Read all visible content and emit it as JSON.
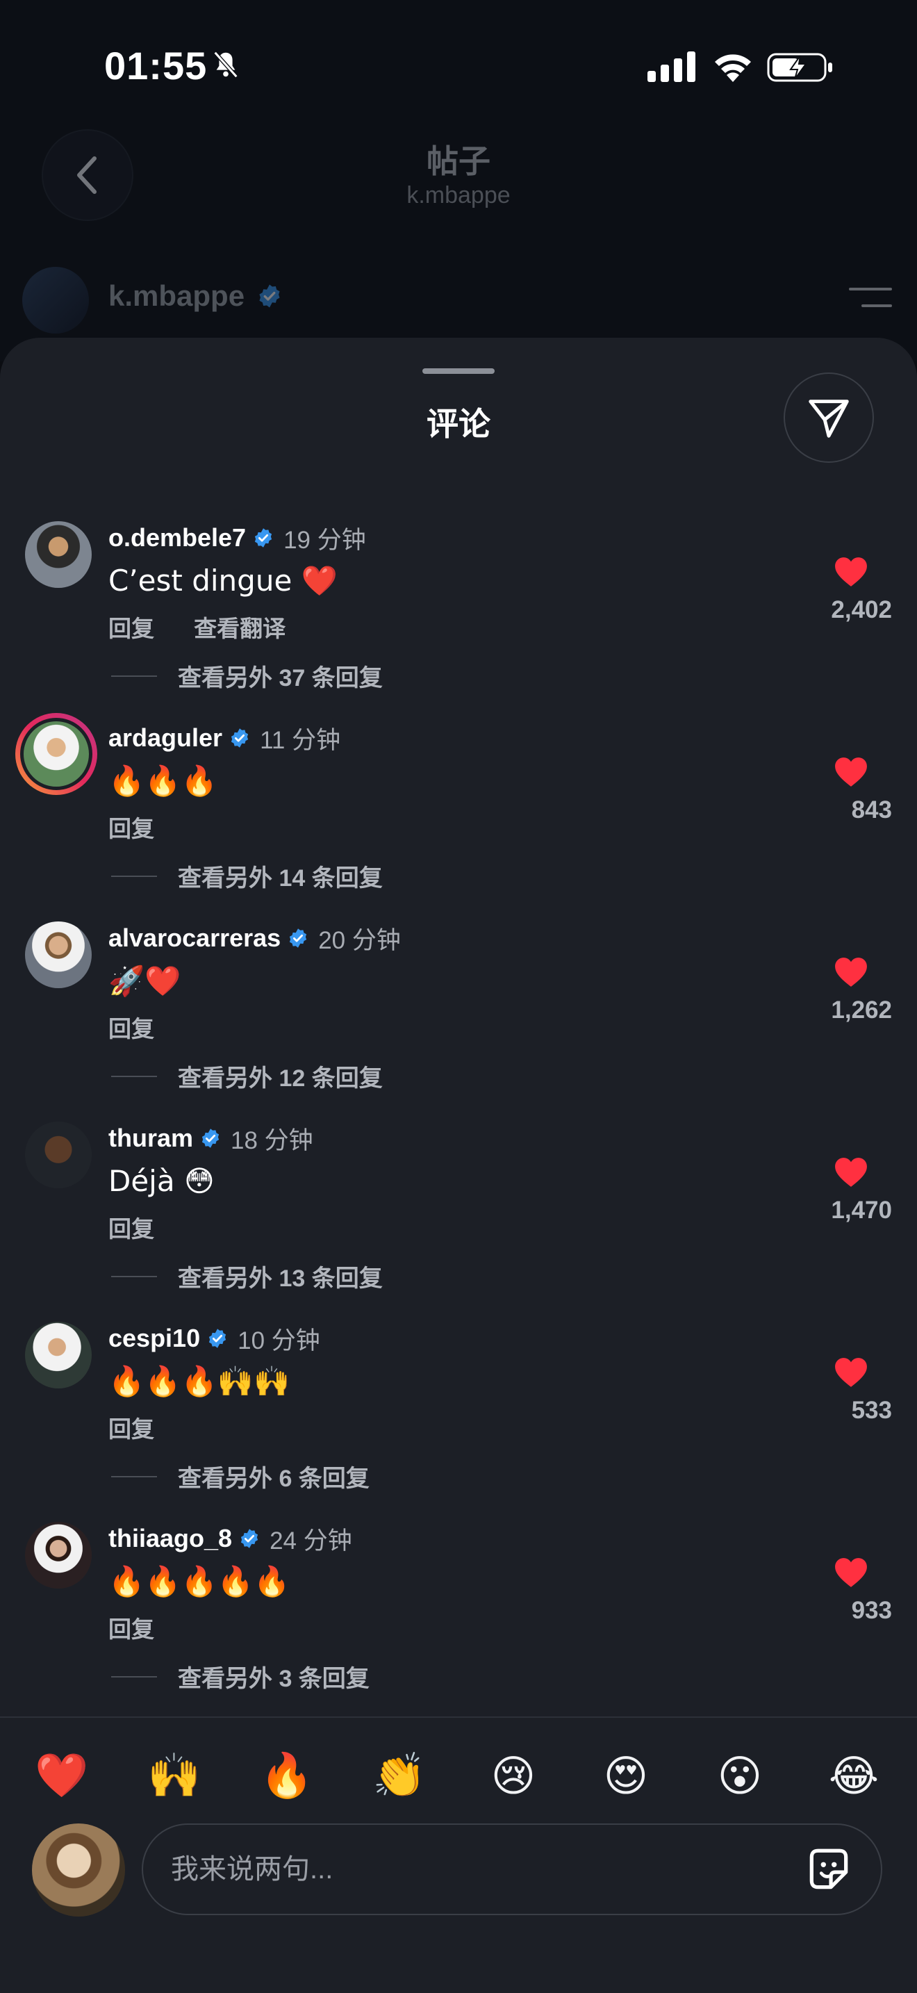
{
  "status": {
    "time": "01:55"
  },
  "nav": {
    "title": "帖子",
    "subtitle": "k.mbappe"
  },
  "post": {
    "username": "k.mbappe"
  },
  "sheet": {
    "title": "评论"
  },
  "comments": [
    {
      "username": "o.dembele7",
      "time": "19 分钟",
      "text": "C’est dingue ❤️",
      "reply": "回复",
      "translate": "查看翻译",
      "replies": "查看另外 37 条回复",
      "likes": "2,402"
    },
    {
      "username": "ardaguler",
      "time": "11 分钟",
      "text": "🔥🔥🔥",
      "reply": "回复",
      "replies": "查看另外 14 条回复",
      "likes": "843"
    },
    {
      "username": "alvarocarreras",
      "time": "20 分钟",
      "text": "🚀❤️",
      "reply": "回复",
      "replies": "查看另外 12 条回复",
      "likes": "1,262"
    },
    {
      "username": "thuram",
      "time": "18 分钟",
      "text": "Déjà 😳",
      "reply": "回复",
      "replies": "查看另外 13 条回复",
      "likes": "1,470"
    },
    {
      "username": "cespi10",
      "time": "10 分钟",
      "text": "🔥🔥🔥🙌🙌",
      "reply": "回复",
      "replies": "查看另外 6 条回复",
      "likes": "533"
    },
    {
      "username": "thiiaago_8",
      "time": "24 分钟",
      "text": "🔥🔥🔥🔥🔥",
      "reply": "回复",
      "replies": "查看另外 3 条回复",
      "likes": "933"
    }
  ],
  "reactions": [
    "❤️",
    "🙌",
    "🔥",
    "👏",
    "😢",
    "😍",
    "😮",
    "😂"
  ],
  "composer": {
    "placeholder": "我来说两句..."
  },
  "colors": {
    "accent_like": "#ff3040",
    "verified": "#3897f0",
    "sheet_bg": "#1c1f26"
  },
  "icons": [
    "mute-bell-icon",
    "signal-icon",
    "wifi-icon",
    "battery-charging-icon",
    "back-chevron-icon",
    "verified-badge-icon",
    "menu-icon",
    "share-send-icon",
    "heart-icon",
    "sticker-icon"
  ]
}
